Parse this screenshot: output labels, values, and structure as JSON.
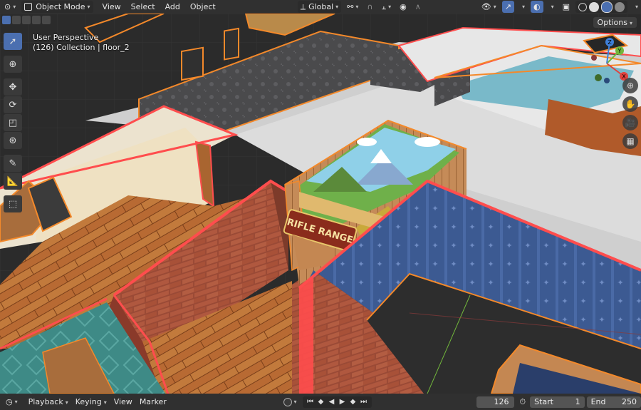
{
  "header": {
    "mode": "Object Mode",
    "menus": [
      "View",
      "Select",
      "Add",
      "Object"
    ],
    "transform_orientation": "Global",
    "options_label": "Options"
  },
  "viewport": {
    "perspective": "User Perspective",
    "collection": "(126) Collection | floor_2",
    "sign_text": "RIFLE RANGE",
    "gizmo_axes": [
      "X",
      "Y",
      "Z"
    ]
  },
  "timeline": {
    "menus": [
      "Playback",
      "Keying",
      "View",
      "Marker"
    ],
    "current_frame": "126",
    "start_label": "Start",
    "start_value": "1",
    "end_label": "End",
    "end_value": "250"
  },
  "colors": {
    "selection_orange": "#f4892a",
    "selection_red": "#ff4d4d",
    "accent_blue": "#4b6fb0",
    "x_axis": "#e0433f",
    "y_axis": "#72b73c",
    "z_axis": "#3e7fd9"
  }
}
